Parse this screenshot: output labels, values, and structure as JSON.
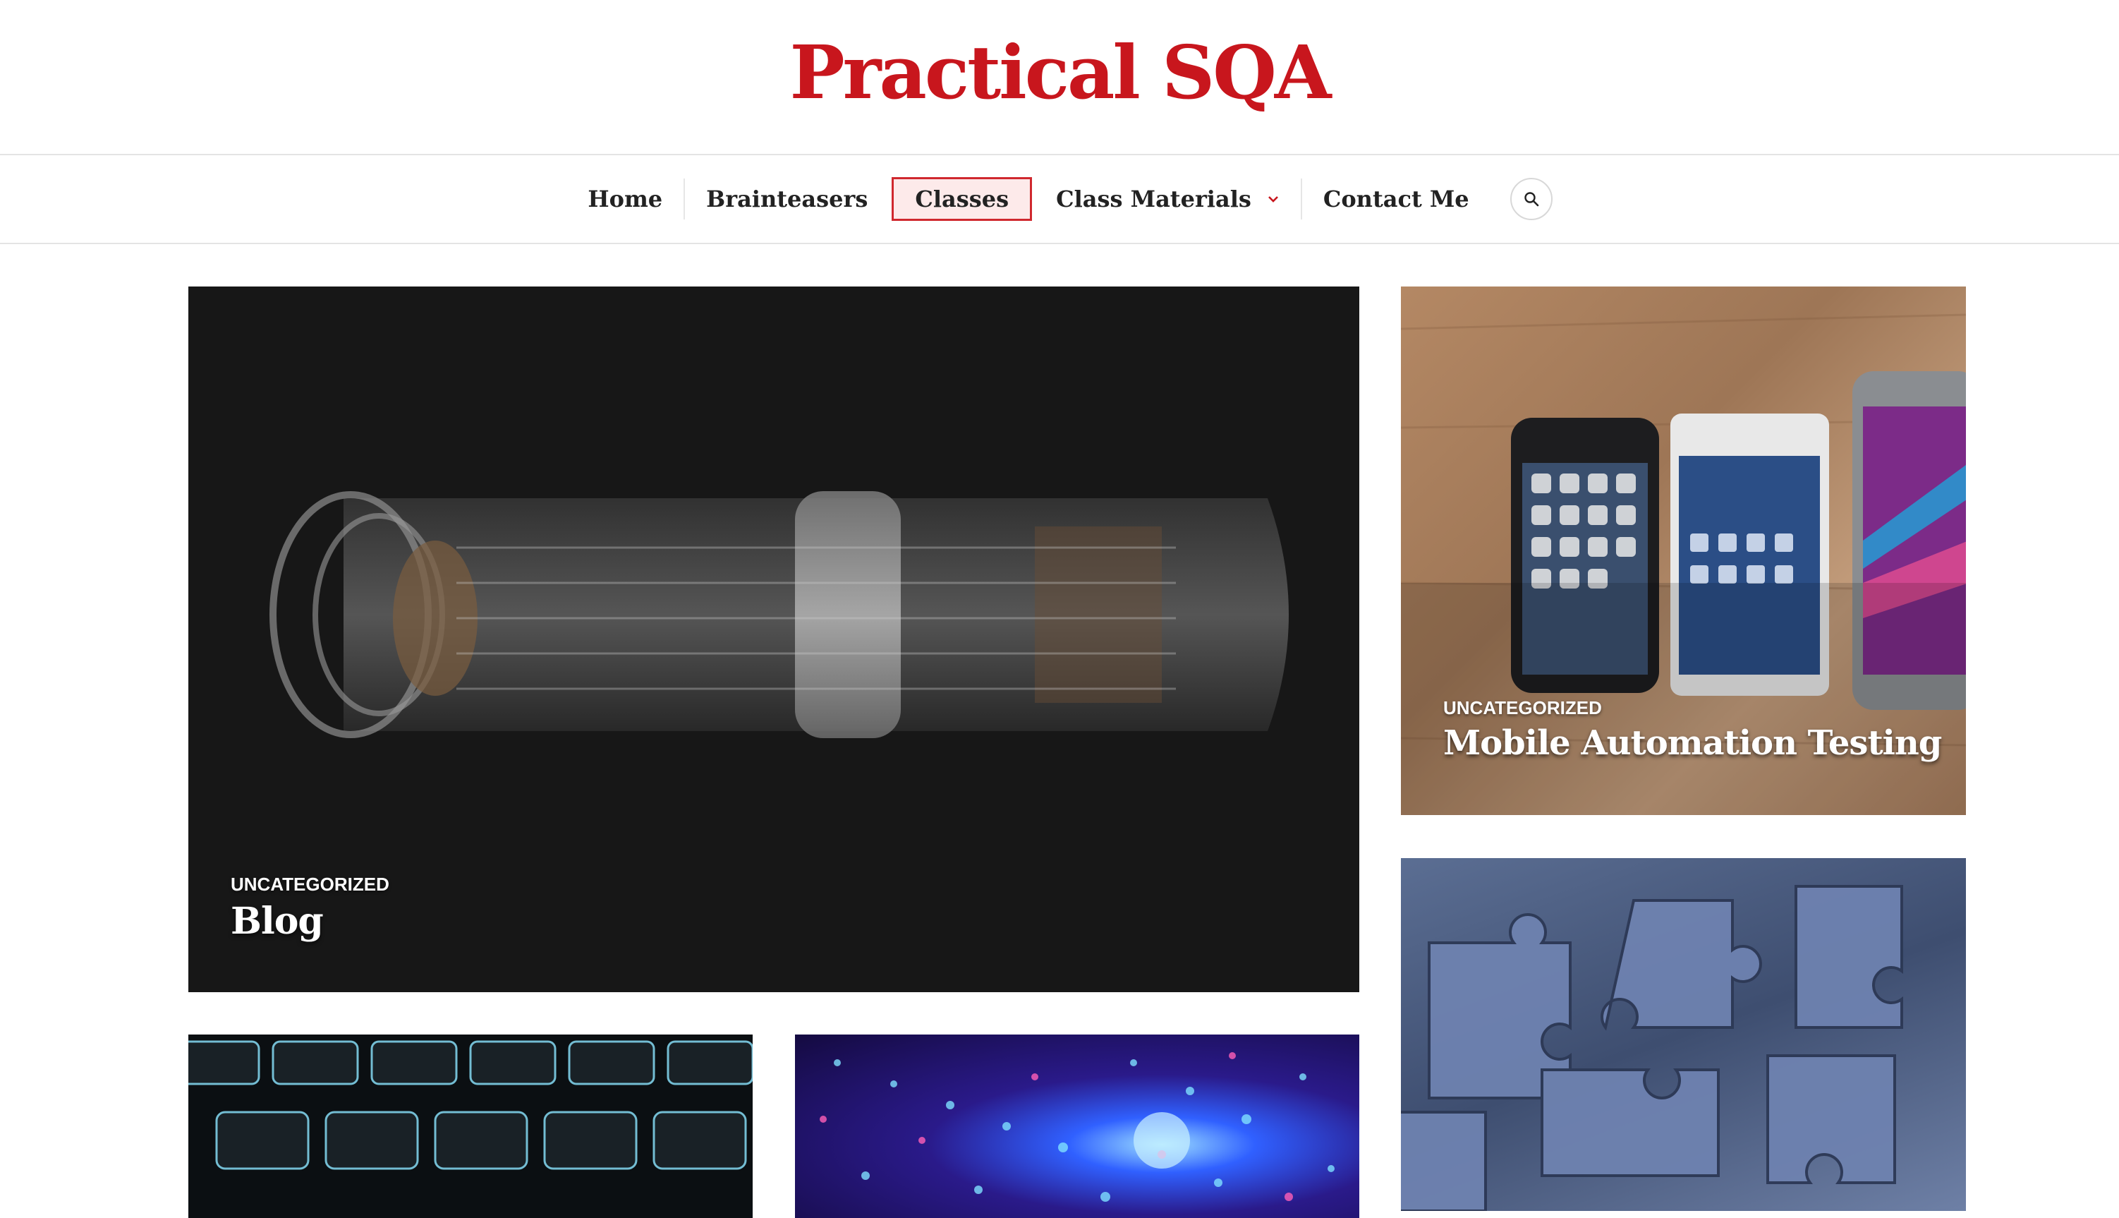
{
  "site": {
    "title": "Practical SQA"
  },
  "nav": {
    "items": [
      {
        "label": "Home"
      },
      {
        "label": "Brainteasers"
      },
      {
        "label": "Classes",
        "active": true
      },
      {
        "label": "Class Materials",
        "has_dropdown": true
      },
      {
        "label": "Contact Me"
      }
    ],
    "search_icon": "search-icon",
    "dropdown_icon": "chevron-down-icon"
  },
  "posts": [
    {
      "category": "UNCATEGORIZED",
      "title": "Blog"
    },
    {
      "category": "UNCATEGORIZED",
      "title": "Mobile Automation Testing"
    }
  ],
  "colors": {
    "brand": "#c8161d",
    "active_nav_border": "#d0282e",
    "active_nav_bg": "#fdeaea"
  }
}
